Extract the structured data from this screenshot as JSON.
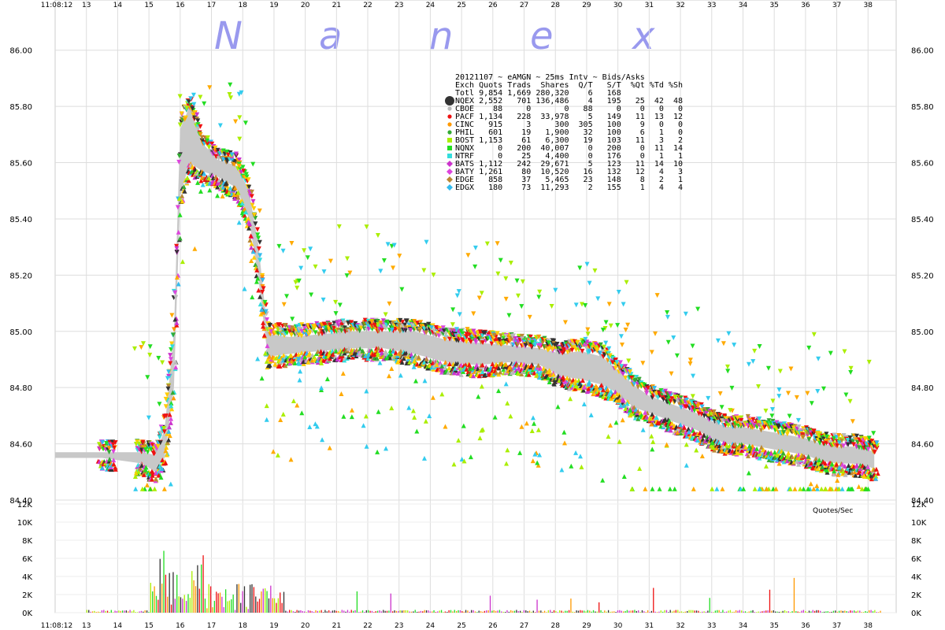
{
  "watermark": [
    "N",
    "a",
    "n",
    "e",
    "x"
  ],
  "chart_data": {
    "type": "scatter",
    "title": "20121107 ~ eAMGN ~ 25ms Intv ~ Bids/Asks",
    "time_start_label": "11:08:12",
    "x_ticks": [
      "13",
      "14",
      "15",
      "16",
      "17",
      "18",
      "19",
      "20",
      "21",
      "22",
      "23",
      "24",
      "25",
      "26",
      "27",
      "28",
      "29",
      "30",
      "31",
      "32",
      "33",
      "34",
      "35",
      "36",
      "37",
      "38"
    ],
    "price_axis": {
      "ylim": [
        84.4,
        86.1
      ],
      "ticks": [
        "86.00",
        "85.80",
        "85.60",
        "85.40",
        "85.20",
        "85.00",
        "84.80",
        "84.60",
        "84.40"
      ]
    },
    "quote_axis": {
      "label": "Quotes/Sec",
      "ylim": [
        0,
        12000
      ],
      "ticks": [
        "12K",
        "10K",
        "8K",
        "6K",
        "4K",
        "2K",
        "0K"
      ]
    },
    "legend_header": "Exch Quots Trads  Shares  Q/T   S/T  %Qt %Td %Sh",
    "legend": [
      {
        "exch": "Totl",
        "quotes": "9,854",
        "trades": "1,669",
        "shares": "280,320",
        "qt": "6",
        "st": "168",
        "pq": "",
        "pt": "",
        "ps": "",
        "color": "#333333",
        "marker": "none"
      },
      {
        "exch": "NQEX",
        "quotes": "2,552",
        "trades": "701",
        "shares": "136,486",
        "qt": "4",
        "st": "195",
        "pq": "25",
        "pt": "42",
        "ps": "48",
        "color": "#333333",
        "marker": "bigcircle"
      },
      {
        "exch": "CBOE",
        "quotes": "88",
        "trades": "0",
        "shares": "0",
        "qt": "88",
        "st": "0",
        "pq": "0",
        "pt": "0",
        "ps": "0",
        "color": "#bbbbbb",
        "marker": "circle"
      },
      {
        "exch": "PACF",
        "quotes": "1,134",
        "trades": "228",
        "shares": "33,978",
        "qt": "5",
        "st": "149",
        "pq": "11",
        "pt": "13",
        "ps": "12",
        "color": "#ee1111",
        "marker": "circle"
      },
      {
        "exch": "CINC",
        "quotes": "915",
        "trades": "3",
        "shares": "300",
        "qt": "305",
        "st": "100",
        "pq": "9",
        "pt": "0",
        "ps": "0",
        "color": "#ff9900",
        "marker": "circle"
      },
      {
        "exch": "PHIL",
        "quotes": "601",
        "trades": "19",
        "shares": "1,900",
        "qt": "32",
        "st": "100",
        "pq": "6",
        "pt": "1",
        "ps": "0",
        "color": "#33aa33",
        "marker": "circle"
      },
      {
        "exch": "BOST",
        "quotes": "1,153",
        "trades": "61",
        "shares": "6,300",
        "qt": "19",
        "st": "103",
        "pq": "11",
        "pt": "3",
        "ps": "2",
        "color": "#aaee00",
        "marker": "square"
      },
      {
        "exch": "NQNX",
        "quotes": "0",
        "trades": "200",
        "shares": "40,007",
        "qt": "0",
        "st": "200",
        "pq": "0",
        "pt": "11",
        "ps": "14",
        "color": "#22dd22",
        "marker": "square"
      },
      {
        "exch": "NTRF",
        "quotes": "0",
        "trades": "25",
        "shares": "4,400",
        "qt": "0",
        "st": "176",
        "pq": "0",
        "pt": "1",
        "ps": "1",
        "color": "#33dddd",
        "marker": "square"
      },
      {
        "exch": "BATS",
        "quotes": "1,112",
        "trades": "242",
        "shares": "29,671",
        "qt": "5",
        "st": "123",
        "pq": "11",
        "pt": "14",
        "ps": "10",
        "color": "#cc33cc",
        "marker": "diamond"
      },
      {
        "exch": "BATY",
        "quotes": "1,261",
        "trades": "80",
        "shares": "10,520",
        "qt": "16",
        "st": "132",
        "pq": "12",
        "pt": "4",
        "ps": "3",
        "color": "#dd44dd",
        "marker": "diamond"
      },
      {
        "exch": "EDGE",
        "quotes": "858",
        "trades": "37",
        "shares": "5,465",
        "qt": "23",
        "st": "148",
        "pq": "8",
        "pt": "2",
        "ps": "1",
        "color": "#bb8833",
        "marker": "diamond"
      },
      {
        "exch": "EDGX",
        "quotes": "180",
        "trades": "73",
        "shares": "11,293",
        "qt": "2",
        "st": "155",
        "pq": "1",
        "pt": "4",
        "ps": "4",
        "color": "#33bbee",
        "marker": "diamond"
      }
    ],
    "nbbo_midline": {
      "x": [
        12.0,
        13.5,
        14.8,
        15.2,
        15.5,
        15.8,
        16.0,
        16.3,
        16.7,
        17.2,
        17.8,
        18.2,
        18.5,
        18.8,
        19.5,
        20.5,
        21.5,
        22.5,
        23.5,
        24.5,
        25.5,
        26.5,
        27.5,
        28.2,
        28.8,
        29.5,
        30.0,
        30.5,
        31.0,
        31.5,
        32.0,
        32.5,
        33.0,
        33.5,
        34.0,
        34.5,
        35.0,
        35.5,
        36.0,
        36.5,
        37.0,
        37.5,
        38.0,
        38.2
      ],
      "y": [
        84.56,
        84.56,
        84.55,
        84.53,
        84.6,
        84.9,
        85.6,
        85.7,
        85.62,
        85.58,
        85.55,
        85.45,
        85.25,
        84.95,
        84.95,
        84.96,
        84.97,
        84.97,
        84.96,
        84.93,
        84.92,
        84.92,
        84.91,
        84.88,
        84.88,
        84.86,
        84.82,
        84.77,
        84.74,
        84.72,
        84.7,
        84.68,
        84.65,
        84.63,
        84.63,
        84.62,
        84.61,
        84.6,
        84.59,
        84.57,
        84.56,
        84.56,
        84.55,
        84.54
      ],
      "spread": [
        0.01,
        0.01,
        0.02,
        0.03,
        0.05,
        0.1,
        0.12,
        0.1,
        0.05,
        0.03,
        0.04,
        0.05,
        0.06,
        0.04,
        0.03,
        0.03,
        0.03,
        0.03,
        0.04,
        0.04,
        0.04,
        0.03,
        0.03,
        0.04,
        0.05,
        0.05,
        0.04,
        0.04,
        0.03,
        0.03,
        0.03,
        0.03,
        0.03,
        0.03,
        0.03,
        0.03,
        0.03,
        0.03,
        0.03,
        0.03,
        0.03,
        0.03,
        0.03,
        0.03
      ]
    },
    "x_range": [
      12.0,
      38.9
    ]
  }
}
